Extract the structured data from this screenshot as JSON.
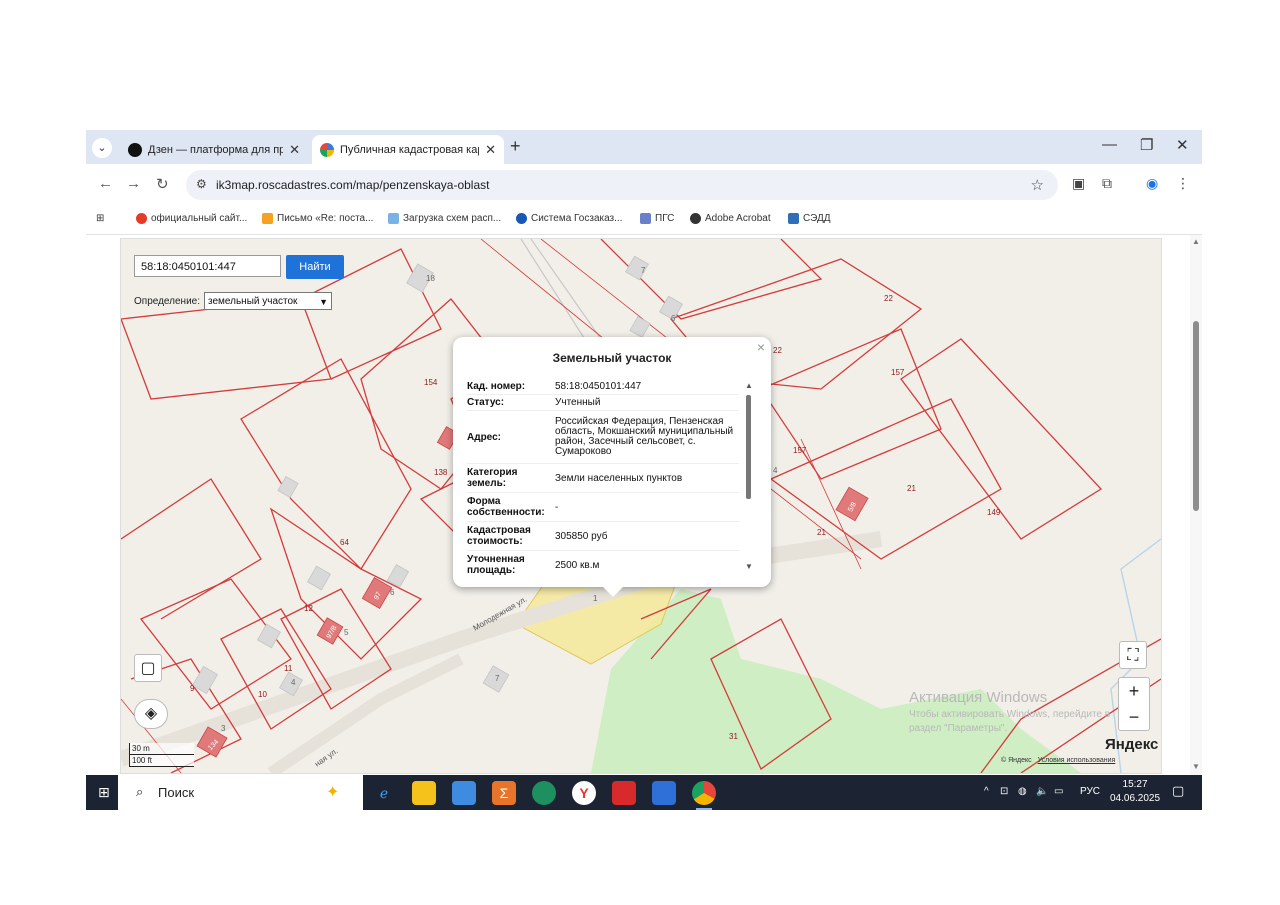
{
  "browser": {
    "tabs": [
      {
        "title": "Дзен — платформа для прос",
        "active": false
      },
      {
        "title": "Публичная кадастровая карта",
        "active": true
      }
    ],
    "url": "ik3map.roscadastres.com/map/penzenskaya-oblast",
    "bookmarks": [
      {
        "label": "официальный сайт..."
      },
      {
        "label": "Письмо «Re: поста..."
      },
      {
        "label": "Загрузка схем расп..."
      },
      {
        "label": "Система Госзаказ..."
      },
      {
        "label": "ПГС"
      },
      {
        "label": "Adobe Acrobat"
      },
      {
        "label": "СЭДД"
      }
    ]
  },
  "search": {
    "value": "58:18:0450101:447",
    "button": "Найти"
  },
  "definition": {
    "label": "Определение:",
    "value": "земельный участок"
  },
  "popup": {
    "title": "Земельный участок",
    "rows": [
      {
        "key": "Кад. номер:",
        "value": "58:18:0450101:447"
      },
      {
        "key": "Статус:",
        "value": "Учтенный"
      },
      {
        "key": "Адрес:",
        "value": "Российская Федерация, Пензенская область, Мокшанский муниципальный район, Засечный сельсовет, с. Сумароково"
      },
      {
        "key": "Категория земель:",
        "value": "Земли населенных пунктов"
      },
      {
        "key": "Форма собственности:",
        "value": "-"
      },
      {
        "key": "Кадастровая стоимость:",
        "value": "305850 руб"
      },
      {
        "key": "Уточненная площадь:",
        "value": "2500 кв.м"
      }
    ]
  },
  "map": {
    "labels": {
      "n18": "18",
      "n7a": "7",
      "n6": "6",
      "n22a": "22",
      "n22b": "22",
      "n157a": "157",
      "n157b": "157",
      "n154": "154",
      "n138": "138",
      "n4a": "4",
      "n21a": "21",
      "n21b": "21",
      "n149": "149",
      "n64": "64",
      "n12": "12",
      "n6b": "6",
      "n5": "5",
      "n11": "11",
      "n4b": "4",
      "n9": "9",
      "n10": "10",
      "n7b": "7",
      "n31": "31",
      "n1": "1",
      "n3": "3",
      "house1": "5/8",
      "house2": "97",
      "house3": "97/8",
      "house4": "134"
    },
    "streets": {
      "main": "Молодежная ул.",
      "lower": "ная ул."
    },
    "scale": {
      "metric": "30 m",
      "imperial": "100 ft"
    },
    "watermark": {
      "line1": "Активация Windows",
      "line2": "Чтобы активировать Windows, перейдите в",
      "line3": "раздел \"Параметры\"."
    },
    "provider": "Яндекс",
    "copyright": {
      "owner": "© Яндекс",
      "terms": "Условия использования"
    }
  },
  "taskbar": {
    "search_label": "Поиск",
    "lang": "РУС",
    "time": "15:27",
    "date": "04.06.2025"
  },
  "colors": {
    "parcel_line": "#d33c3c",
    "selected_fill": "#f6e79a",
    "accent": "#1f73d8",
    "green": "#cfeec4"
  }
}
